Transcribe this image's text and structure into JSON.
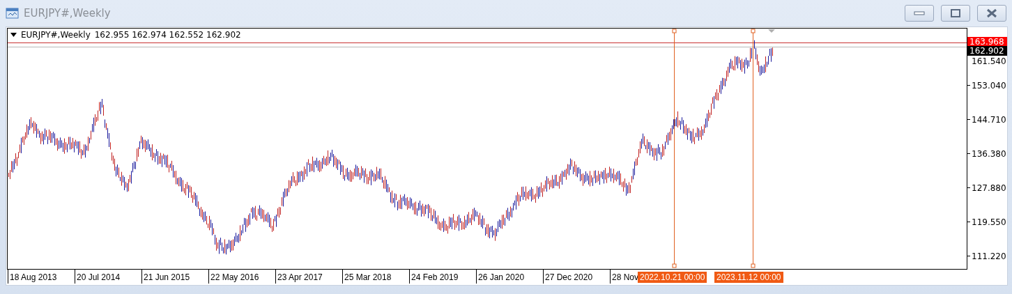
{
  "window": {
    "title": "EURJPY#,Weekly"
  },
  "chart": {
    "symbol": "EURJPY#,Weekly",
    "ohlc": "162.955 162.974 162.552 162.902",
    "price_tags": [
      {
        "text": "163.968",
        "color": "#ff0000"
      },
      {
        "text": "162.902",
        "color": "#000000"
      }
    ],
    "price_labels": [
      "161.540",
      "153.040",
      "144.710",
      "136.380",
      "127.880",
      "119.550",
      "111.220"
    ],
    "time_labels": [
      "18 Aug 2013",
      "20 Jul 2014",
      "21 Jun 2015",
      "22 May 2016",
      "23 Apr 2017",
      "25 Mar 2018",
      "24 Feb 2019",
      "26 Jan 2020",
      "27 Dec 2020",
      "28 Nov"
    ],
    "vertical_lines": [
      {
        "label": "2022.10.21 00:00"
      },
      {
        "label": "2023.11.12 00:00"
      }
    ]
  }
}
